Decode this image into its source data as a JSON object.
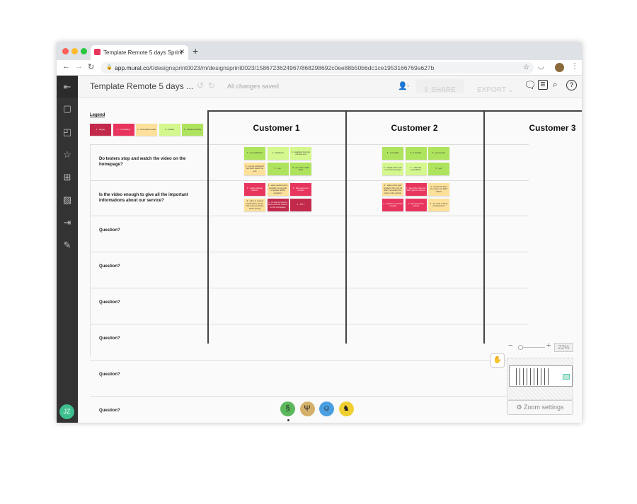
{
  "browser": {
    "tab_title": "Template Remote 5 days Sprint",
    "url_host": "app.mural.co",
    "url_path": "/t/designsprint0023/m/designsprint0023/1586723624967/868298692c0ee88b50b6dc1ce1953166769a627b"
  },
  "header": {
    "title": "Template Remote 5 days ...",
    "save_status": "All changes saved",
    "users_count": "1",
    "share_label": "SHARE",
    "export_label": "EXPORT"
  },
  "sidebar": {
    "icons": [
      "sticky-note-icon",
      "shapes-icon",
      "star-icon",
      "grid-icon",
      "image-icon",
      "import-icon",
      "pencil-icon"
    ],
    "user_initials": "JZ"
  },
  "board": {
    "legend_title": "Legend",
    "legend": [
      {
        "label": "1 · bug(s)",
        "level": 1
      },
      {
        "label": "2 · not working",
        "level": 2
      },
      {
        "label": "3 · somewhat trouble",
        "level": 3
      },
      {
        "label": "4 · positive",
        "level": 4
      },
      {
        "label": "5 · worked perfectly",
        "level": 5
      }
    ],
    "columns": [
      "Customer 1",
      "Customer 2",
      "Customer 3"
    ],
    "questions": [
      "Do testers stop and watch the video on the homepage?",
      "Is the video enough to give all the important informations about our service?",
      "Question?",
      "Question?",
      "Question?",
      "Question?",
      "Question?",
      "Question?"
    ],
    "stickies": [
      {
        "row": 0,
        "col": 0,
        "items": [
          {
            "t": "5 · yes watched it",
            "l": 5
          },
          {
            "t": "4 · watched it",
            "l": 4
          },
          {
            "t": "4 · watched it but not until the end",
            "l": 4
          },
          {
            "t": "3 · yes he watched it but didn't watch the end",
            "l": 3
          },
          {
            "t": "5 · yes",
            "l": 5
          },
          {
            "t": "5 · yes, saw it right away",
            "l": 5
          }
        ]
      },
      {
        "row": 0,
        "col": 1,
        "items": [
          {
            "t": "5 · yes totally",
            "l": 5
          },
          {
            "t": "5 · it worked",
            "l": 5
          },
          {
            "t": "5 · yes loved it",
            "l": 5
          },
          {
            "t": "4 · maybe voice over is not loud enough",
            "l": 4
          },
          {
            "t": "4 · \"I like the soundtrack\"",
            "l": 4
          },
          {
            "t": "5 · yes!",
            "l": 5
          }
        ]
      },
      {
        "row": 1,
        "col": 0,
        "items": [
          {
            "t": "2 · maybe subtext below?",
            "l": 2
          },
          {
            "t": "3 · video works but it's probably not enough to answer all the questions",
            "l": 3
          },
          {
            "t": "2 · We need more content",
            "l": 2
          },
          {
            "t": "3 · video is a good introduction, but he had some questions about pricing",
            "l": 3
          },
          {
            "t": "1 · I'd say we need to add more text content on the homepage",
            "l": 1
          },
          {
            "t": "1 · NO :(",
            "l": 1
          }
        ]
      },
      {
        "row": 1,
        "col": 1,
        "items": [
          {
            "t": "3 · video is the right media for him, but he didn't remember the name of the service",
            "l": 3
          },
          {
            "t": "2 · loved the video but didn't get our service",
            "l": 2
          },
          {
            "t": "3 · at least he liked the music, but didn't deliver",
            "l": 3
          },
          {
            "t": "2 · content is not clear enough",
            "l": 2
          },
          {
            "t": "2 · We need more content",
            "l": 2
          },
          {
            "t": "3 · we need to bring pricing before",
            "l": 3
          }
        ]
      }
    ]
  },
  "zoom": {
    "level": "22%",
    "settings_label": "Zoom settings"
  },
  "collaborators": [
    {
      "icon": "seahorse-icon",
      "color": "#5cb85c"
    },
    {
      "icon": "giraffe-icon",
      "color": "#d4b06a"
    },
    {
      "icon": "monkey-icon",
      "color": "#4a9fe0"
    },
    {
      "icon": "cat-icon",
      "color": "#f0d030"
    }
  ],
  "colors": {
    "level1": "#c2294a",
    "level2": "#e8355e",
    "level3": "#fde19a",
    "level4": "#d4f78e",
    "level5": "#aee35d",
    "sidebar": "#333333"
  }
}
